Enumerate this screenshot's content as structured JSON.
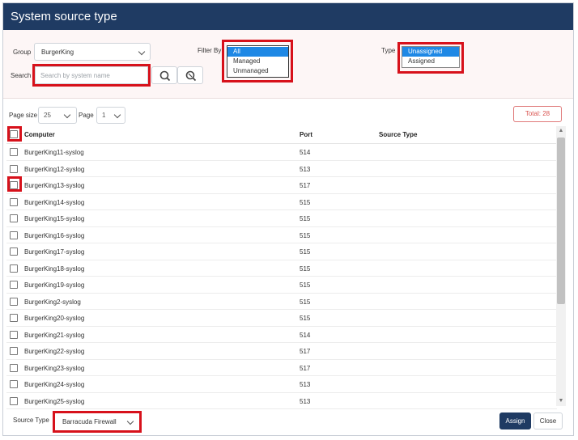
{
  "dialog": {
    "title": "System source type"
  },
  "filters": {
    "group_label": "Group",
    "group_value": "BurgerKing",
    "filter_by_label": "Filter By",
    "filter_by_options": [
      "All",
      "Managed",
      "Unmanaged"
    ],
    "filter_by_selected": "All",
    "type_label": "Type",
    "type_options": [
      "Unassigned",
      "Assigned"
    ],
    "type_selected": "Unassigned",
    "search_label": "Search",
    "search_placeholder": "Search by system name"
  },
  "paging": {
    "page_size_label": "Page size",
    "page_size_value": "25",
    "page_label": "Page",
    "page_value": "1",
    "total_label": "Total:",
    "total_value": "28"
  },
  "table": {
    "columns": [
      "Computer",
      "Port",
      "Source Type"
    ],
    "rows": [
      {
        "computer": "BurgerKing11-syslog",
        "port": "514",
        "source_type": ""
      },
      {
        "computer": "BurgerKing12-syslog",
        "port": "513",
        "source_type": ""
      },
      {
        "computer": "BurgerKing13-syslog",
        "port": "517",
        "source_type": ""
      },
      {
        "computer": "BurgerKing14-syslog",
        "port": "515",
        "source_type": ""
      },
      {
        "computer": "BurgerKing15-syslog",
        "port": "515",
        "source_type": ""
      },
      {
        "computer": "BurgerKing16-syslog",
        "port": "515",
        "source_type": ""
      },
      {
        "computer": "BurgerKing17-syslog",
        "port": "515",
        "source_type": ""
      },
      {
        "computer": "BurgerKing18-syslog",
        "port": "515",
        "source_type": ""
      },
      {
        "computer": "BurgerKing19-syslog",
        "port": "515",
        "source_type": ""
      },
      {
        "computer": "BurgerKing2-syslog",
        "port": "515",
        "source_type": ""
      },
      {
        "computer": "BurgerKing20-syslog",
        "port": "515",
        "source_type": ""
      },
      {
        "computer": "BurgerKing21-syslog",
        "port": "514",
        "source_type": ""
      },
      {
        "computer": "BurgerKing22-syslog",
        "port": "517",
        "source_type": ""
      },
      {
        "computer": "BurgerKing23-syslog",
        "port": "517",
        "source_type": ""
      },
      {
        "computer": "BurgerKing24-syslog",
        "port": "513",
        "source_type": ""
      },
      {
        "computer": "BurgerKing25-syslog",
        "port": "513",
        "source_type": ""
      }
    ]
  },
  "footer": {
    "source_type_label": "Source Type",
    "source_type_value": "Barracuda Firewall",
    "assign_label": "Assign",
    "close_label": "Close"
  },
  "icons": [
    "search-icon",
    "clear-search-icon",
    "chevron-down-icon",
    "scroll-up-icon",
    "scroll-down-icon"
  ],
  "colors": {
    "titlebar": "#1f3b63",
    "highlight": "#d7111b",
    "selected_option": "#1e88e5",
    "total": "#d9534f"
  }
}
